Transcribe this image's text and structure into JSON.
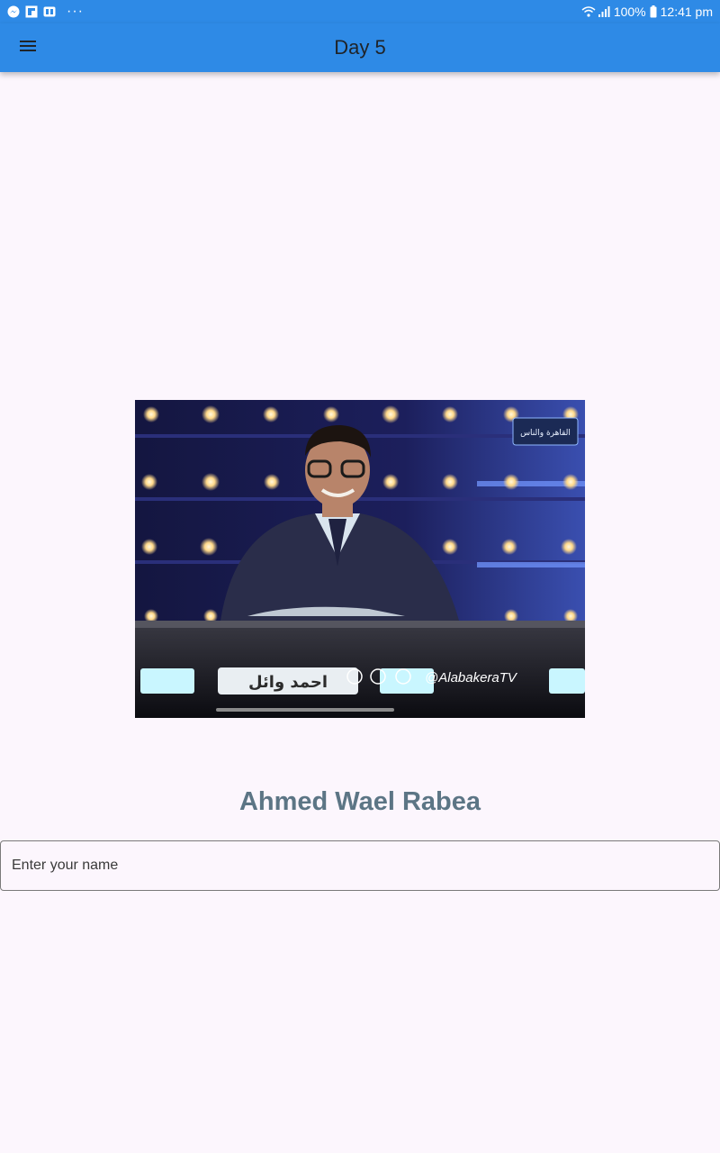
{
  "status_bar": {
    "left_icons": [
      "messenger-icon",
      "flipboard-icon",
      "gallery-icon",
      "more-dots-icon"
    ],
    "more": "···",
    "battery": "100%",
    "time": "12:41 pm"
  },
  "app_bar": {
    "title": "Day 5",
    "menu_icon": "menu-icon",
    "color": "#2e8ae6"
  },
  "video": {
    "overlay_handle": "@AlabakeraTV",
    "channel_logo": "القاهرة والناس",
    "name_caption": "احمد وائل"
  },
  "main": {
    "person_name": "Ahmed Wael Rabea",
    "name_input": {
      "placeholder": "Enter your name",
      "value": ""
    }
  }
}
